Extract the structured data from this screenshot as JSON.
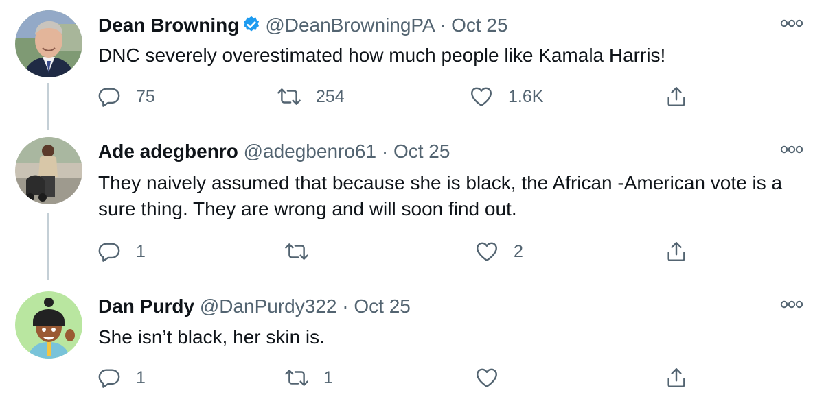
{
  "tweets": [
    {
      "name": "Dean Browning",
      "verified": true,
      "handle": "@DeanBrowningPA",
      "separator": "·",
      "date": "Oct 25",
      "text": "DNC severely overestimated how much people like Kamala Harris!",
      "replies": "75",
      "retweets": "254",
      "likes": "1.6K"
    },
    {
      "name": "Ade adegbenro",
      "verified": false,
      "handle": "@adegbenro61",
      "separator": "·",
      "date": "Oct 25",
      "text": "They naively assumed that because she is black, the African -American vote is a sure thing. They are wrong and will soon find out.",
      "replies": "1",
      "retweets": "",
      "likes": "2"
    },
    {
      "name": "Dan Purdy",
      "verified": false,
      "handle": "@DanPurdy322",
      "separator": "·",
      "date": "Oct 25",
      "text": "She isn’t black, her skin is.",
      "replies": "1",
      "retweets": "1",
      "likes": ""
    }
  ],
  "icons": {
    "reply": "reply-icon",
    "retweet": "retweet-icon",
    "like": "heart-icon",
    "share": "share-icon",
    "more": "more-icon",
    "verified": "verified-badge-icon"
  },
  "colors": {
    "text": "#0f1419",
    "secondary": "#536471",
    "verified": "#1d9bf0",
    "thread_line": "#c4cfd6"
  }
}
